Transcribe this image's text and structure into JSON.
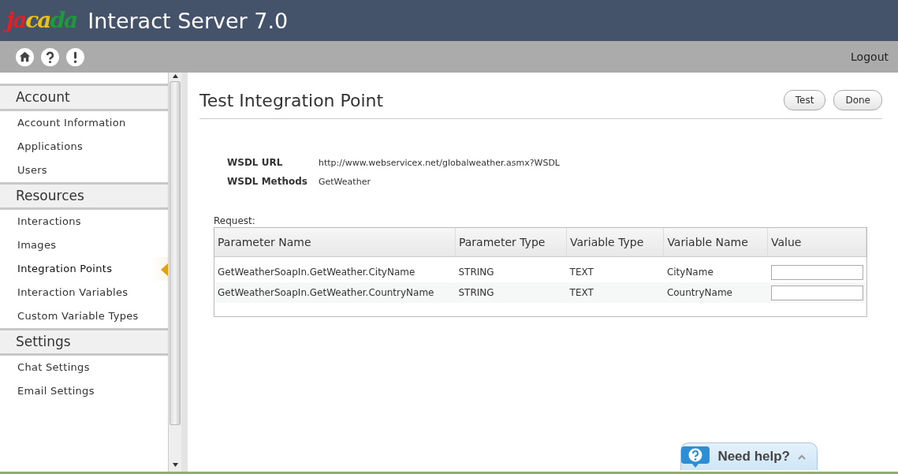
{
  "header": {
    "logo": "jacada",
    "title": "Interact Server 7.0"
  },
  "toolbar": {
    "logout": "Logout"
  },
  "sidebar": {
    "sections": [
      {
        "title": "Account",
        "items": [
          {
            "label": "Account Information",
            "selected": false
          },
          {
            "label": "Applications",
            "selected": false
          },
          {
            "label": "Users",
            "selected": false
          }
        ]
      },
      {
        "title": "Resources",
        "items": [
          {
            "label": "Interactions",
            "selected": false
          },
          {
            "label": "Images",
            "selected": false
          },
          {
            "label": "Integration Points",
            "selected": true
          },
          {
            "label": "Interaction Variables",
            "selected": false
          },
          {
            "label": "Custom Variable Types",
            "selected": false
          }
        ]
      },
      {
        "title": "Settings",
        "items": [
          {
            "label": "Chat Settings",
            "selected": false
          },
          {
            "label": "Email Settings",
            "selected": false
          }
        ]
      }
    ]
  },
  "page": {
    "title": "Test Integration Point",
    "buttons": [
      "Test",
      "Done"
    ],
    "fields": [
      {
        "label": "WSDL URL",
        "value": "http://www.webservicex.net/globalweather.asmx?WSDL"
      },
      {
        "label": "WSDL Methods",
        "value": "GetWeather"
      }
    ],
    "request_label": "Request:",
    "table": {
      "columns": [
        "Parameter Name",
        "Parameter Type",
        "Variable Type",
        "Variable Name",
        "Value"
      ],
      "rows": [
        {
          "cells": [
            "GetWeatherSoapIn.GetWeather.CityName",
            "STRING",
            "TEXT",
            "CityName"
          ]
        },
        {
          "cells": [
            "GetWeatherSoapIn.GetWeather.CountryName",
            "STRING",
            "TEXT",
            "CountryName"
          ]
        }
      ]
    }
  },
  "help": {
    "label": "Need help?"
  }
}
